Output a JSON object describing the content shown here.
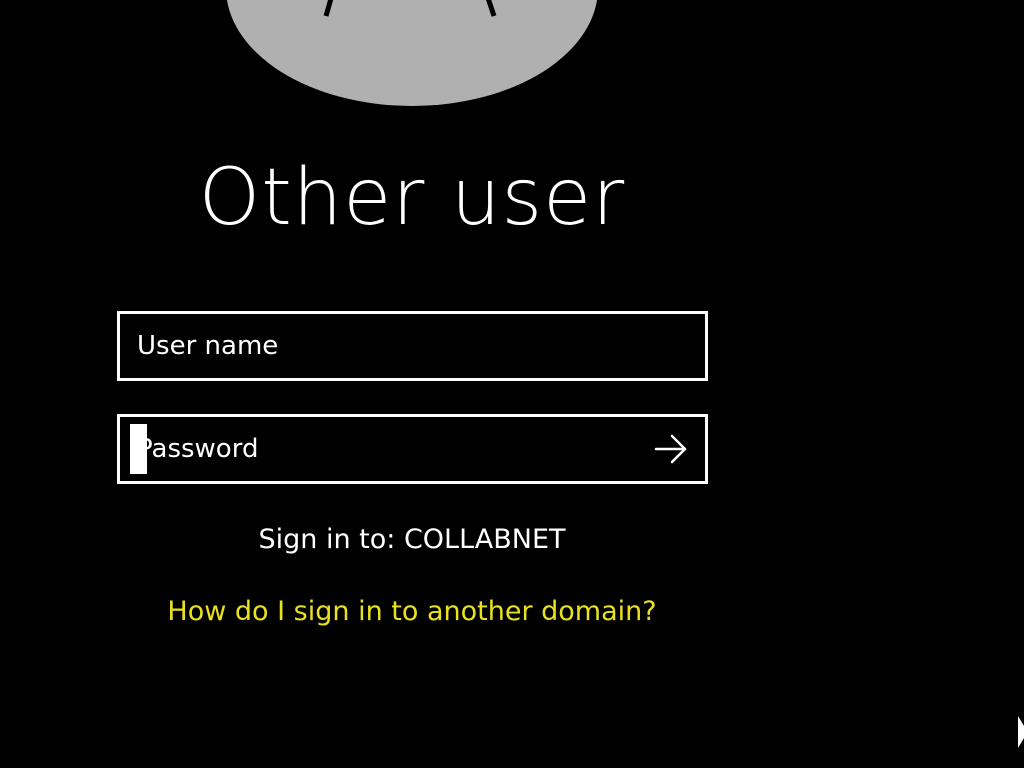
{
  "title": "Other user",
  "username": {
    "placeholder": "User name",
    "value": ""
  },
  "password": {
    "placeholder": "Password",
    "value": ""
  },
  "submit": {
    "icon": "arrow-right-icon"
  },
  "sign_in_to": "Sign in to: COLLABNET",
  "domain_link": "How do I sign in to another domain?",
  "colors": {
    "background": "#000000",
    "text": "#ffffff",
    "link": "#e7e11f",
    "avatar": "#b0b0b0"
  },
  "icons": {
    "avatar": "user-avatar-icon",
    "ease_of_access": "ease-of-access-icon"
  }
}
